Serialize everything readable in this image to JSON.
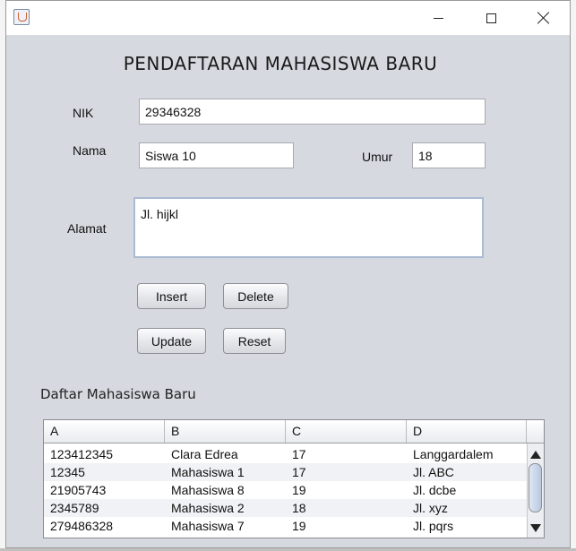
{
  "window": {
    "icon": "java-icon",
    "controls": [
      "minimize-icon",
      "maximize-icon",
      "close-icon"
    ]
  },
  "form": {
    "title": "PENDAFTARAN MAHASISWA BARU",
    "nik_label": "NIK",
    "nik_value": "29346328",
    "nama_label": "Nama",
    "nama_value": "Siswa 10",
    "umur_label": "Umur",
    "umur_value": "18",
    "alamat_label": "Alamat",
    "alamat_value": "Jl. hijkl"
  },
  "buttons": {
    "insert": "Insert",
    "delete": "Delete",
    "update": "Update",
    "reset": "Reset"
  },
  "table": {
    "title": "Daftar Mahasiswa Baru",
    "headers": [
      "A",
      "B",
      "C",
      "D"
    ],
    "rows": [
      [
        "123412345",
        "Clara Edrea",
        "17",
        "Langgardalem"
      ],
      [
        "12345",
        "Mahasiswa 1",
        "17",
        "Jl. ABC"
      ],
      [
        "21905743",
        "Mahasiswa 8",
        "19",
        "Jl. dcbe"
      ],
      [
        "2345789",
        "Mahasiswa 2",
        "18",
        "Jl. xyz"
      ],
      [
        "279486328",
        "Mahasiswa 7",
        "19",
        "Jl. pqrs"
      ]
    ]
  }
}
